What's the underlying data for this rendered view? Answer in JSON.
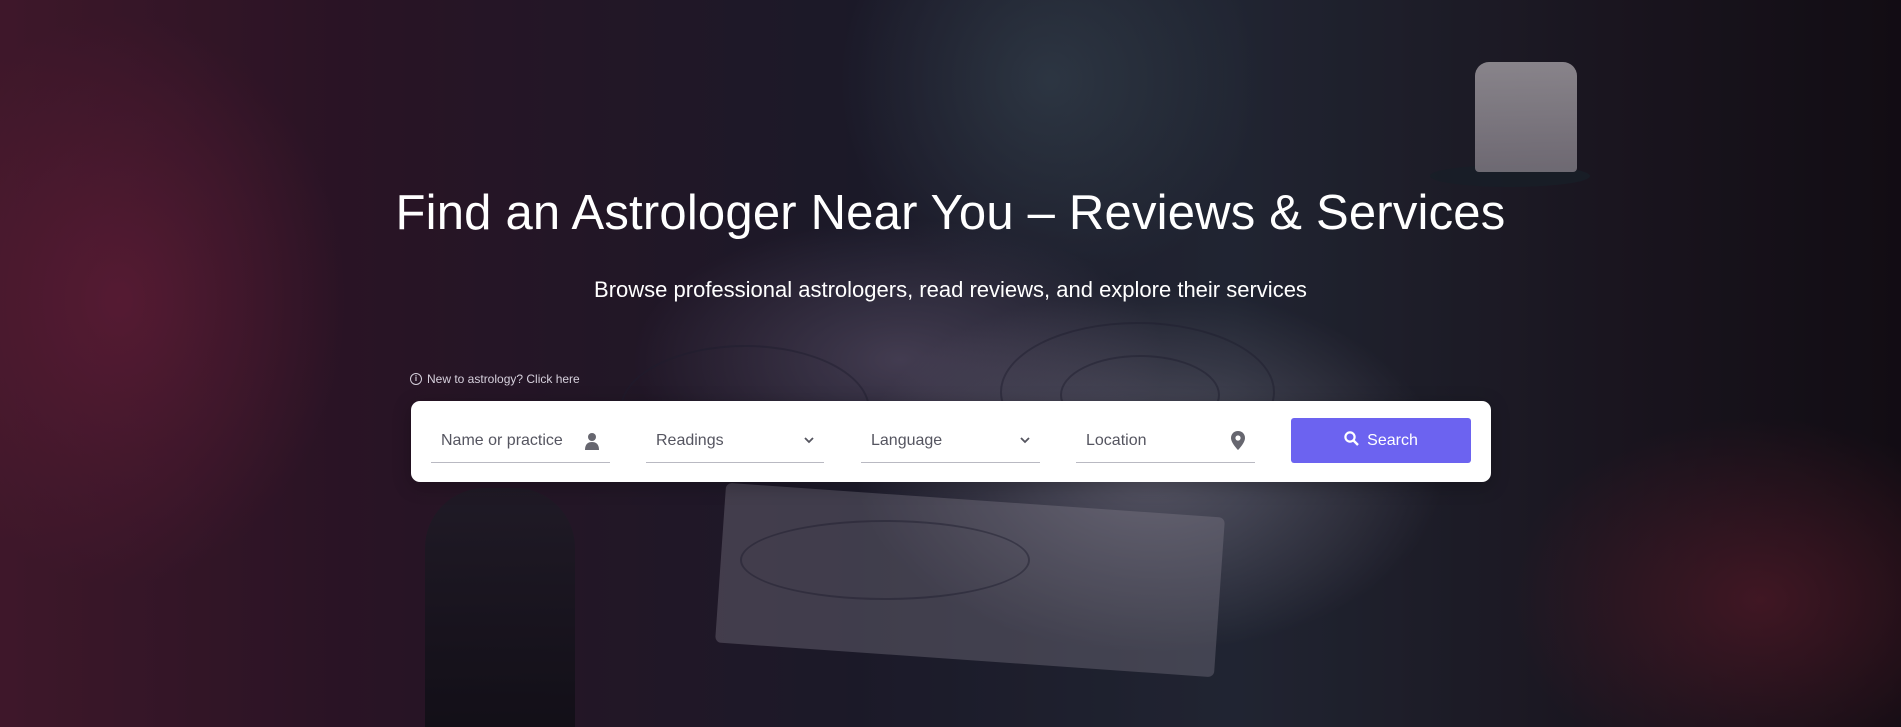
{
  "hero": {
    "title": "Find an Astrologer Near You – Reviews & Services",
    "subtitle": "Browse professional astrologers, read reviews, and explore their services",
    "help_link": "New to astrology? Click here"
  },
  "search": {
    "name_placeholder": "Name or practice",
    "readings_selected": "Readings",
    "language_selected": "Language",
    "location_placeholder": "Location",
    "button_label": "Search"
  },
  "colors": {
    "accent": "#6c63f0",
    "panel": "#ffffff",
    "text_light": "#ffffff",
    "field_text": "#555560"
  },
  "icons": {
    "info": "info-icon",
    "name": "person-icon",
    "readings": "chevron-down-icon",
    "language": "chevron-down-icon",
    "location": "map-pin-icon",
    "search": "search-icon"
  }
}
